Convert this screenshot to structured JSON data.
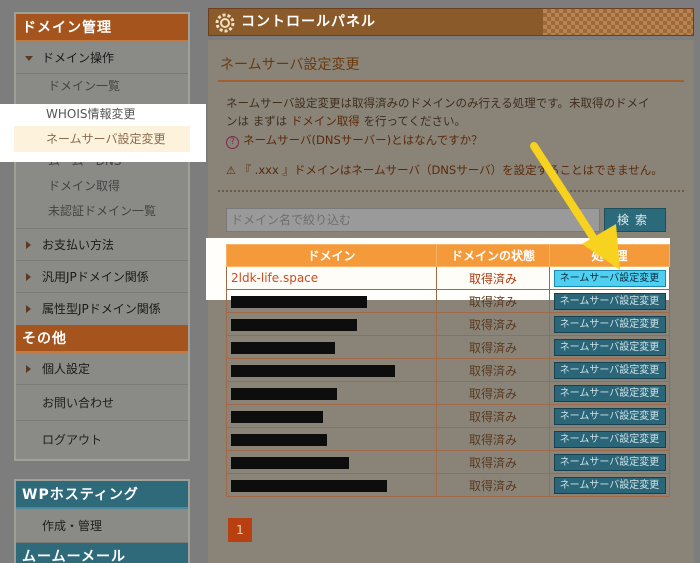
{
  "sidebar": {
    "domain_header": "ドメイン管理",
    "domain_ops": "ドメイン操作",
    "sub_items": [
      "ドメイン一覧",
      "WHOIS情報変更",
      "ネームサーバ設定変更",
      "ムームーDNS",
      "ドメイン取得",
      "未認証ドメイン一覧"
    ],
    "payment": "お支払い方法",
    "generic_jp": "汎用JPドメイン関係",
    "attr_jp": "属性型JPドメイン関係",
    "other_header": "その他",
    "personal": "個人設定",
    "contact": "お問い合わせ",
    "logout": "ログアウト",
    "wp_header": "WPホスティング",
    "wp_item": "作成・管理",
    "mail_header": "ムームーメール"
  },
  "panel": {
    "title": "コントロールパネル",
    "section_title": "ネームサーバ設定変更",
    "info_line1": "ネームサーバ設定変更は取得済みのドメインのみ行える処理です。未取得のドメイ",
    "info_line2_pre": "ンは まずは ",
    "info_link": "ドメイン取得",
    "info_line2_post": " を行ってください。",
    "question": "ネームサーバ(DNSサーバー)とはなんですか？",
    "warning": "『 .xxx 』ドメインはネームサーバ（DNSサーバ）を設定することはできません。",
    "search_placeholder": "ドメイン名で絞り込む",
    "search_button": "検索"
  },
  "table": {
    "headers": [
      "ドメイン",
      "ドメインの状態",
      "処　理"
    ],
    "first_domain": "2ldk-life.space",
    "status": "取得済み",
    "action": "ネームサーバ設定変更",
    "redacted_widths": [
      136,
      126,
      104,
      164,
      106,
      92,
      96,
      118,
      156
    ]
  },
  "pager": {
    "current": "1"
  },
  "colors": {
    "accent_orange": "#f59a3a",
    "highlight_button": "#4fd0f0",
    "arrow": "#f7d21e"
  }
}
